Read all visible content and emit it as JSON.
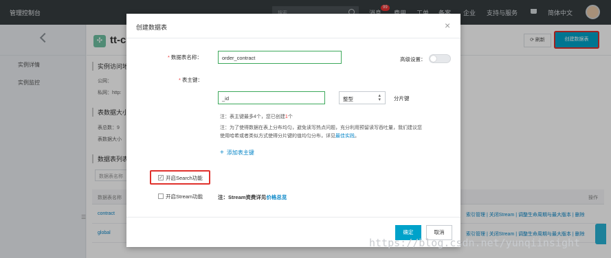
{
  "topbar": {
    "brand": "管理控制台",
    "search_placeholder": "搜索",
    "nav": [
      "消息",
      "费用",
      "工单",
      "备案",
      "企业",
      "支持与服务",
      "简体中文"
    ],
    "message_badge": "99"
  },
  "sidebar": {
    "items": [
      "实例详情",
      "实例监控"
    ]
  },
  "main": {
    "app_title": "tt-c",
    "refresh_label": "刷新",
    "create_table_label": "创建数据表",
    "section_access": "实例访问地",
    "public_label": "公网：",
    "private_label": "私网：http:",
    "section_table_size": "表数据大小",
    "table_count_label": "表总数：9",
    "table_size_label": "表数据大小",
    "section_table_list": "数据表列表",
    "table_search_placeholder": "数据表名称",
    "col_name": "数据表名称",
    "col_ops": "操作",
    "rows": [
      {
        "name": "contract",
        "ops": "索引管理 | 关闭Stream | 调整生命周期与最大版本 | 删除"
      },
      {
        "name": "global",
        "ops": "索引管理 | 关闭Stream | 调整生命周期与最大版本 | 删除"
      }
    ]
  },
  "modal": {
    "title": "创建数据表",
    "table_name_label": "数据表名称：",
    "table_name_value": "order_contract",
    "advanced_label": "高级设置：",
    "pk_label": "表主键：",
    "pk_value": "_id",
    "pk_type": "整型",
    "partition_key_label": "分片键",
    "note1_prefix": "注：表主键最多4个，您已创建",
    "note1_count": "1",
    "note1_suffix": "个",
    "note2_line1": "注：为了使得数据在表上分布均匀，避免读写热点问题，充分利用预留读写吞吐量，我们建议您",
    "note2_line2_prefix": "使用哈希或者类似方式使得分片键的值均匀分布，详见",
    "note2_link": "最佳实践",
    "note2_end": "。",
    "add_pk_label": "添加表主键",
    "search_checkbox_label": "开启Search功能",
    "stream_checkbox_label": "开启Stream功能",
    "stream_note_prefix": "注：Stream资费详见",
    "stream_note_link": "价格总览",
    "ok_label": "确定",
    "cancel_label": "取消"
  },
  "watermark": "https://blog.csdn.net/yunqiinsight",
  "colors": {
    "primary": "#00a2ca",
    "highlight": "#e0302b",
    "valid_border": "#3ca85a",
    "topbar": "#373d41"
  }
}
